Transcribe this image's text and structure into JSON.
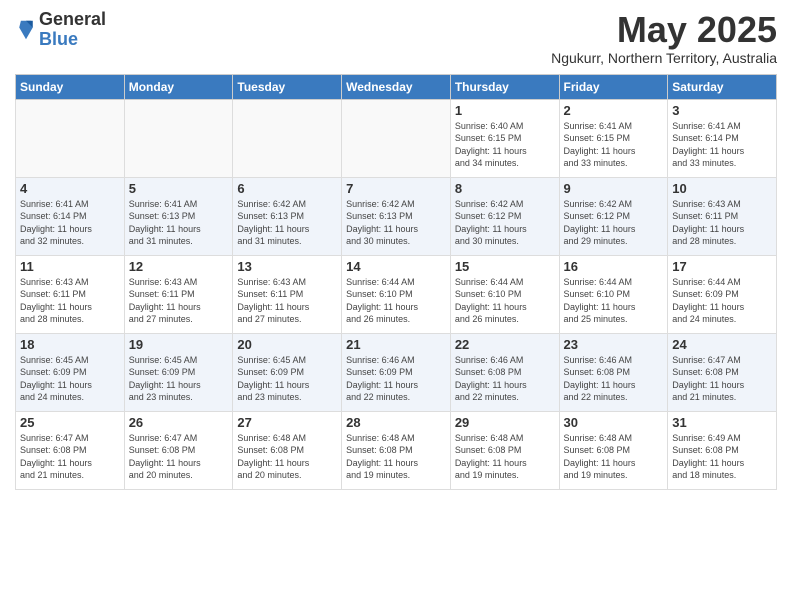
{
  "logo": {
    "general": "General",
    "blue": "Blue"
  },
  "title": "May 2025",
  "subtitle": "Ngukurr, Northern Territory, Australia",
  "days_header": [
    "Sunday",
    "Monday",
    "Tuesday",
    "Wednesday",
    "Thursday",
    "Friday",
    "Saturday"
  ],
  "weeks": [
    [
      {
        "day": "",
        "info": ""
      },
      {
        "day": "",
        "info": ""
      },
      {
        "day": "",
        "info": ""
      },
      {
        "day": "",
        "info": ""
      },
      {
        "day": "1",
        "info": "Sunrise: 6:40 AM\nSunset: 6:15 PM\nDaylight: 11 hours\nand 34 minutes."
      },
      {
        "day": "2",
        "info": "Sunrise: 6:41 AM\nSunset: 6:15 PM\nDaylight: 11 hours\nand 33 minutes."
      },
      {
        "day": "3",
        "info": "Sunrise: 6:41 AM\nSunset: 6:14 PM\nDaylight: 11 hours\nand 33 minutes."
      }
    ],
    [
      {
        "day": "4",
        "info": "Sunrise: 6:41 AM\nSunset: 6:14 PM\nDaylight: 11 hours\nand 32 minutes."
      },
      {
        "day": "5",
        "info": "Sunrise: 6:41 AM\nSunset: 6:13 PM\nDaylight: 11 hours\nand 31 minutes."
      },
      {
        "day": "6",
        "info": "Sunrise: 6:42 AM\nSunset: 6:13 PM\nDaylight: 11 hours\nand 31 minutes."
      },
      {
        "day": "7",
        "info": "Sunrise: 6:42 AM\nSunset: 6:13 PM\nDaylight: 11 hours\nand 30 minutes."
      },
      {
        "day": "8",
        "info": "Sunrise: 6:42 AM\nSunset: 6:12 PM\nDaylight: 11 hours\nand 30 minutes."
      },
      {
        "day": "9",
        "info": "Sunrise: 6:42 AM\nSunset: 6:12 PM\nDaylight: 11 hours\nand 29 minutes."
      },
      {
        "day": "10",
        "info": "Sunrise: 6:43 AM\nSunset: 6:11 PM\nDaylight: 11 hours\nand 28 minutes."
      }
    ],
    [
      {
        "day": "11",
        "info": "Sunrise: 6:43 AM\nSunset: 6:11 PM\nDaylight: 11 hours\nand 28 minutes."
      },
      {
        "day": "12",
        "info": "Sunrise: 6:43 AM\nSunset: 6:11 PM\nDaylight: 11 hours\nand 27 minutes."
      },
      {
        "day": "13",
        "info": "Sunrise: 6:43 AM\nSunset: 6:11 PM\nDaylight: 11 hours\nand 27 minutes."
      },
      {
        "day": "14",
        "info": "Sunrise: 6:44 AM\nSunset: 6:10 PM\nDaylight: 11 hours\nand 26 minutes."
      },
      {
        "day": "15",
        "info": "Sunrise: 6:44 AM\nSunset: 6:10 PM\nDaylight: 11 hours\nand 26 minutes."
      },
      {
        "day": "16",
        "info": "Sunrise: 6:44 AM\nSunset: 6:10 PM\nDaylight: 11 hours\nand 25 minutes."
      },
      {
        "day": "17",
        "info": "Sunrise: 6:44 AM\nSunset: 6:09 PM\nDaylight: 11 hours\nand 24 minutes."
      }
    ],
    [
      {
        "day": "18",
        "info": "Sunrise: 6:45 AM\nSunset: 6:09 PM\nDaylight: 11 hours\nand 24 minutes."
      },
      {
        "day": "19",
        "info": "Sunrise: 6:45 AM\nSunset: 6:09 PM\nDaylight: 11 hours\nand 23 minutes."
      },
      {
        "day": "20",
        "info": "Sunrise: 6:45 AM\nSunset: 6:09 PM\nDaylight: 11 hours\nand 23 minutes."
      },
      {
        "day": "21",
        "info": "Sunrise: 6:46 AM\nSunset: 6:09 PM\nDaylight: 11 hours\nand 22 minutes."
      },
      {
        "day": "22",
        "info": "Sunrise: 6:46 AM\nSunset: 6:08 PM\nDaylight: 11 hours\nand 22 minutes."
      },
      {
        "day": "23",
        "info": "Sunrise: 6:46 AM\nSunset: 6:08 PM\nDaylight: 11 hours\nand 22 minutes."
      },
      {
        "day": "24",
        "info": "Sunrise: 6:47 AM\nSunset: 6:08 PM\nDaylight: 11 hours\nand 21 minutes."
      }
    ],
    [
      {
        "day": "25",
        "info": "Sunrise: 6:47 AM\nSunset: 6:08 PM\nDaylight: 11 hours\nand 21 minutes."
      },
      {
        "day": "26",
        "info": "Sunrise: 6:47 AM\nSunset: 6:08 PM\nDaylight: 11 hours\nand 20 minutes."
      },
      {
        "day": "27",
        "info": "Sunrise: 6:48 AM\nSunset: 6:08 PM\nDaylight: 11 hours\nand 20 minutes."
      },
      {
        "day": "28",
        "info": "Sunrise: 6:48 AM\nSunset: 6:08 PM\nDaylight: 11 hours\nand 19 minutes."
      },
      {
        "day": "29",
        "info": "Sunrise: 6:48 AM\nSunset: 6:08 PM\nDaylight: 11 hours\nand 19 minutes."
      },
      {
        "day": "30",
        "info": "Sunrise: 6:48 AM\nSunset: 6:08 PM\nDaylight: 11 hours\nand 19 minutes."
      },
      {
        "day": "31",
        "info": "Sunrise: 6:49 AM\nSunset: 6:08 PM\nDaylight: 11 hours\nand 18 minutes."
      }
    ]
  ]
}
